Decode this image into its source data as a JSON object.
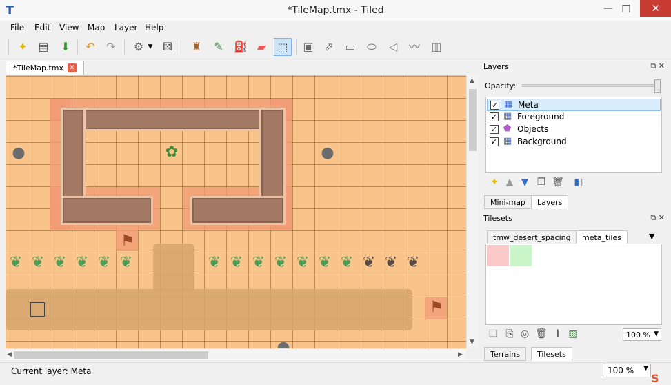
{
  "window": {
    "title": "*TileMap.tmx - Tiled",
    "minimize": "—",
    "maximize": "□",
    "close": "✕"
  },
  "menus": [
    "File",
    "Edit",
    "View",
    "Map",
    "Layer",
    "Help"
  ],
  "toolbar": {
    "icons": [
      "new-icon",
      "open-icon",
      "save-icon",
      "undo-icon",
      "redo-icon",
      "commands-icon",
      "random-icon",
      "stamp-brush-icon",
      "terrain-brush-icon",
      "bucket-fill-icon",
      "eraser-icon",
      "rectangle-select-icon",
      "select-objects-icon",
      "edit-polygons-icon",
      "insert-rectangle-icon",
      "insert-ellipse-icon",
      "insert-polygon-icon",
      "insert-polyline-icon",
      "insert-tile-icon"
    ],
    "active_tool": "rectangle-select-icon"
  },
  "document": {
    "tab_label": "*TileMap.tmx"
  },
  "layers_panel": {
    "title": "Layers",
    "opacity_label": "Opacity:",
    "layers": [
      {
        "name": "Meta",
        "visible": true,
        "type": "tile",
        "selected": true
      },
      {
        "name": "Foreground",
        "visible": true,
        "type": "tile",
        "selected": false
      },
      {
        "name": "Objects",
        "visible": true,
        "type": "object",
        "selected": false
      },
      {
        "name": "Background",
        "visible": true,
        "type": "tile",
        "selected": false
      }
    ],
    "tabs": [
      "Mini-map",
      "Layers"
    ],
    "active_tab": "Layers"
  },
  "tilesets_panel": {
    "title": "Tilesets",
    "tabs": [
      "tmw_desert_spacing",
      "meta_tiles"
    ],
    "active_tab": "meta_tiles",
    "tile_colors": [
      "#f9c9c9",
      "#c9f5c9"
    ],
    "zoom": "100 %",
    "bottom_tabs": [
      "Terrains",
      "Tilesets"
    ],
    "active_bottom_tab": "Tilesets"
  },
  "status": {
    "current_layer": "Current layer: Meta",
    "zoom": "100 %"
  },
  "colors": {
    "sand": "#f8c48a",
    "collision": "#f29b74",
    "wall": "#a27a63",
    "selection": "#d8ecfb"
  }
}
